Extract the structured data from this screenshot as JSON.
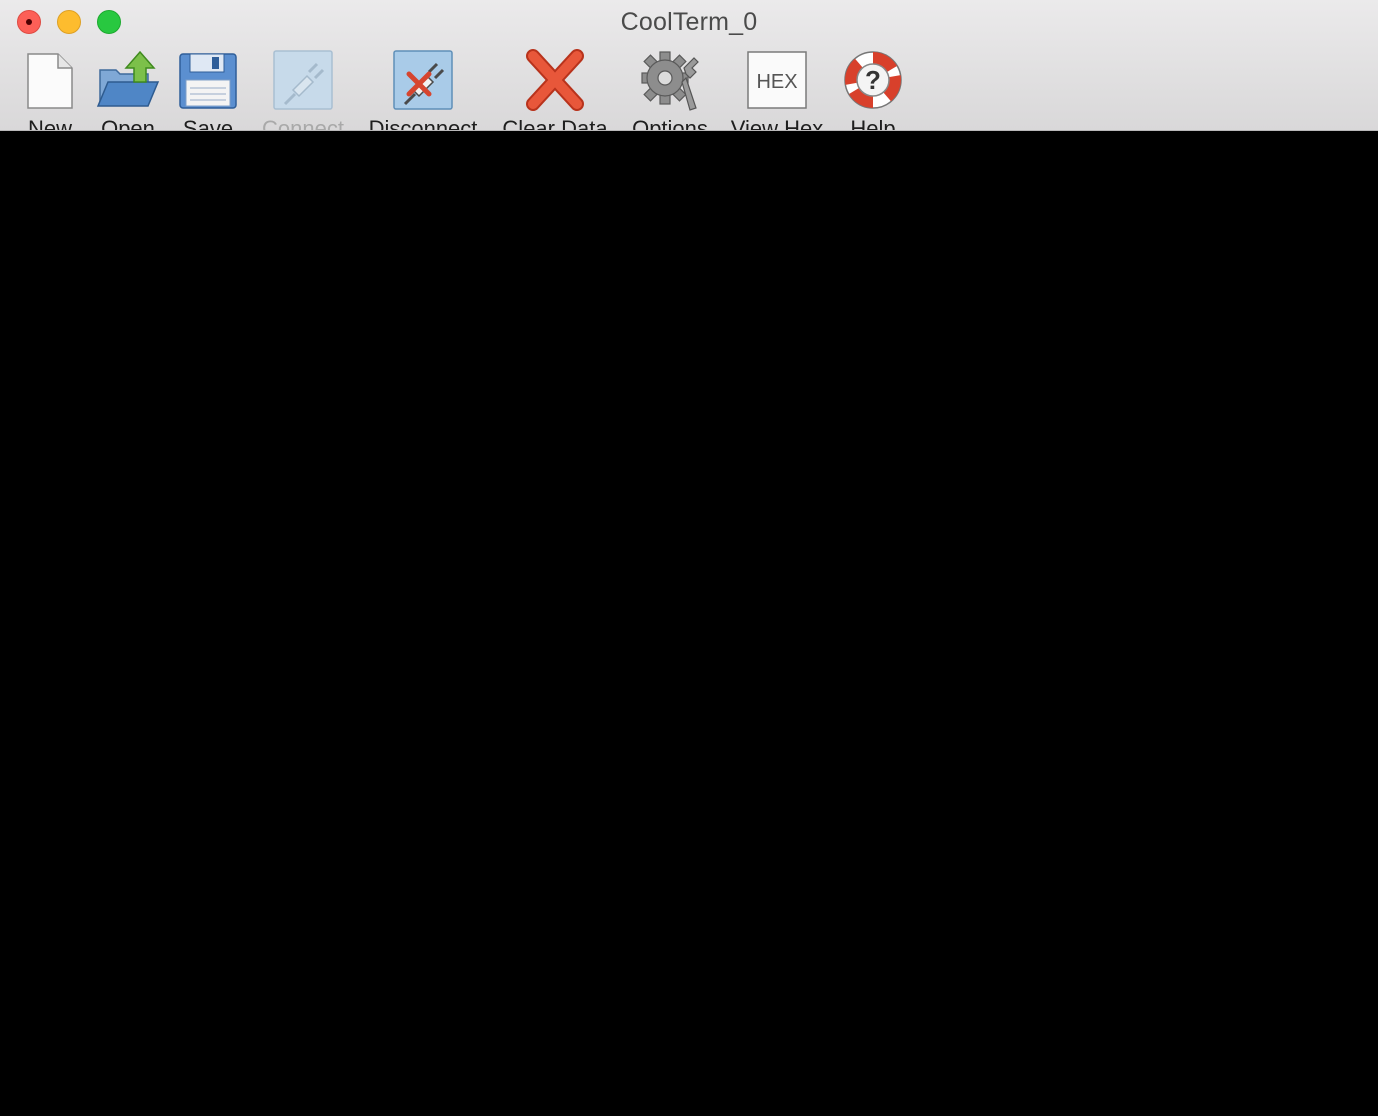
{
  "window": {
    "title": "CoolTerm_0"
  },
  "toolbar": {
    "items": [
      {
        "label": "New",
        "icon": "new-document-icon",
        "enabled": true
      },
      {
        "label": "Open",
        "icon": "open-folder-icon",
        "enabled": true
      },
      {
        "label": "Save",
        "icon": "floppy-disk-icon",
        "enabled": true
      },
      {
        "label": "Connect",
        "icon": "connect-plug-icon",
        "enabled": false
      },
      {
        "label": "Disconnect",
        "icon": "disconnect-plug-icon",
        "enabled": true
      },
      {
        "label": "Clear Data",
        "icon": "red-x-icon",
        "enabled": true
      },
      {
        "label": "Options",
        "icon": "gear-wrench-icon",
        "enabled": true
      },
      {
        "label": "View Hex",
        "icon": "hex-icon",
        "enabled": true
      },
      {
        "label": "Help",
        "icon": "lifebuoy-icon",
        "enabled": true
      }
    ],
    "hex_icon_text": "HEX",
    "help_icon_text": "?"
  },
  "colors": {
    "close": "#fc5f57",
    "minimize": "#fdbc2e",
    "zoom": "#28c840",
    "terminal_background": "#000000",
    "toolbar_background": "#e4e3e4"
  }
}
